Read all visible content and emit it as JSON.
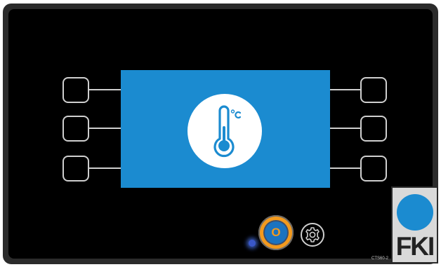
{
  "device": {
    "model_code": "CTS60-2",
    "logo_text": "FKI",
    "colors": {
      "bezel": "#2b2b2b",
      "panel": "#000000",
      "screen": "#1b8bd0",
      "accent_orange": "#f39a1e",
      "logo_blue": "#1b8bd0",
      "key_outline": "#cfcfcf"
    }
  },
  "display": {
    "icon": "thermometer-celsius-icon",
    "icon_unit": "°C"
  },
  "softkeys": {
    "left": [
      "softkey-left-1",
      "softkey-left-2",
      "softkey-left-3"
    ],
    "right": [
      "softkey-right-1",
      "softkey-right-2",
      "softkey-right-3"
    ]
  },
  "controls": {
    "ok_label": "O",
    "ok_icon": "ok-button-icon",
    "settings_icon": "gear-icon",
    "led_icon": "status-led-icon"
  }
}
